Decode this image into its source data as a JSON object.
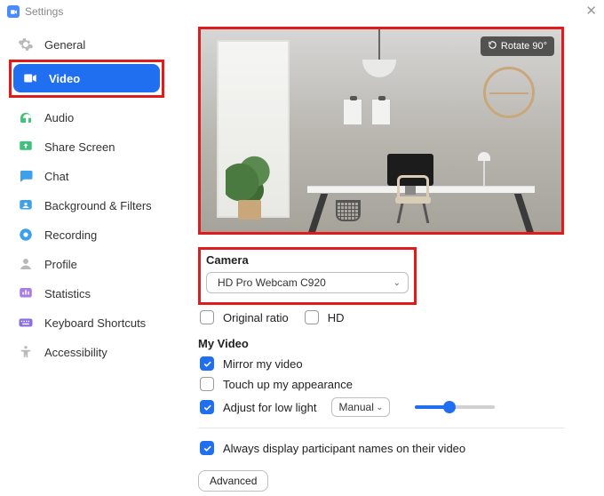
{
  "window": {
    "title": "Settings"
  },
  "sidebar": {
    "items": [
      {
        "label": "General"
      },
      {
        "label": "Video"
      },
      {
        "label": "Audio"
      },
      {
        "label": "Share Screen"
      },
      {
        "label": "Chat"
      },
      {
        "label": "Background & Filters"
      },
      {
        "label": "Recording"
      },
      {
        "label": "Profile"
      },
      {
        "label": "Statistics"
      },
      {
        "label": "Keyboard Shortcuts"
      },
      {
        "label": "Accessibility"
      }
    ]
  },
  "preview": {
    "rotate_label": "Rotate 90°"
  },
  "camera": {
    "heading": "Camera",
    "selected": "HD Pro Webcam C920",
    "original_ratio_label": "Original ratio",
    "hd_label": "HD"
  },
  "my_video": {
    "heading": "My Video",
    "mirror_label": "Mirror my video",
    "touchup_label": "Touch up my appearance",
    "lowlight_label": "Adjust for low light",
    "lowlight_mode": "Manual"
  },
  "participants": {
    "always_display_label": "Always display participant names on their video"
  },
  "advanced": {
    "label": "Advanced"
  }
}
